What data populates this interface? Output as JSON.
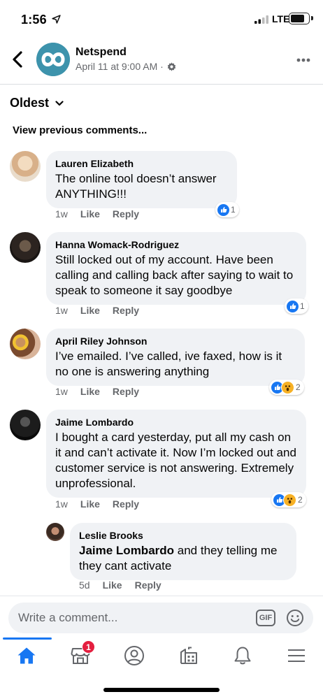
{
  "status_bar": {
    "time": "1:56",
    "network": "LTE"
  },
  "post": {
    "page_name": "Netspend",
    "meta": "April 11 at 9:00 AM ·"
  },
  "sort": {
    "label": "Oldest"
  },
  "view_previous": "View previous comments...",
  "comments": [
    {
      "author": "Lauren Elizabeth",
      "text": "The online tool doesn’t answer ANYTHING!!!",
      "time": "1w",
      "like": "Like",
      "reply": "Reply",
      "reaction_count": "1",
      "reactions": [
        "like"
      ]
    },
    {
      "author": "Hanna Womack-Rodriguez",
      "text": "Still locked out of my account. Have been calling and calling back after saying to wait to speak to someone it say goodbye",
      "time": "1w",
      "like": "Like",
      "reply": "Reply",
      "reaction_count": "1",
      "reactions": [
        "like"
      ]
    },
    {
      "author": "April Riley Johnson",
      "text": "I’ve emailed. I’ve called, ive faxed, how is it no one is answering anything",
      "time": "1w",
      "like": "Like",
      "reply": "Reply",
      "reaction_count": "2",
      "reactions": [
        "like",
        "wow"
      ]
    },
    {
      "author": "Jaime Lombardo",
      "text": "I bought a card yesterday, put all my cash on it and can’t activate it. Now I’m locked out and customer service is not answering. Extremely unprofessional.",
      "time": "1w",
      "like": "Like",
      "reply": "Reply",
      "reaction_count": "2",
      "reactions": [
        "like",
        "wow"
      ]
    }
  ],
  "reply": {
    "author": "Leslie Brooks",
    "mention": "Jaime Lombardo",
    "text": " and they telling me they cant activate",
    "time": "5d",
    "like": "Like",
    "reply": "Reply"
  },
  "composer": {
    "placeholder": "Write a comment...",
    "gif_label": "GIF"
  },
  "tabs": [
    {
      "name": "home",
      "icon": "home-icon",
      "active": true
    },
    {
      "name": "marketplace",
      "icon": "marketplace-icon",
      "badge": "1"
    },
    {
      "name": "profile",
      "icon": "profile-icon"
    },
    {
      "name": "pages",
      "icon": "pages-icon"
    },
    {
      "name": "notifications",
      "icon": "bell-icon"
    },
    {
      "name": "menu",
      "icon": "menu-icon"
    }
  ],
  "colors": {
    "accent": "#1877f2",
    "bubble": "#f0f2f5",
    "secondary_text": "#65676b",
    "badge": "#e41e3f",
    "wow": "#f7b125"
  }
}
